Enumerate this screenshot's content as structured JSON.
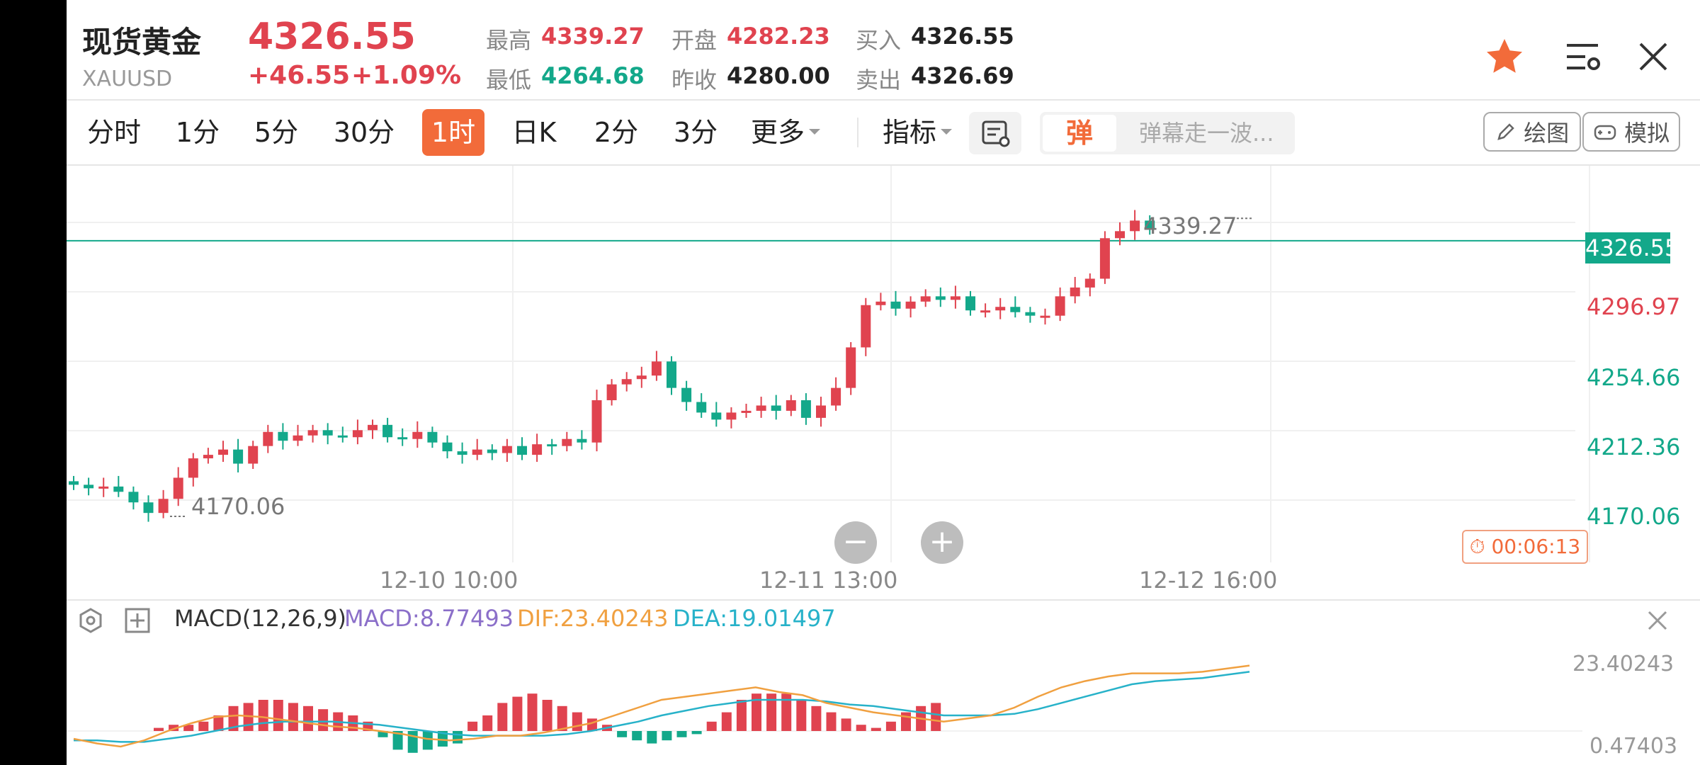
{
  "header": {
    "name": "现货黄金",
    "code": "XAUUSD",
    "price": "4326.55",
    "change": "+46.55",
    "change_pct": "+1.09%",
    "stats": [
      {
        "label": "最高",
        "value": "4339.27",
        "color": "#e0434f"
      },
      {
        "label": "最低",
        "value": "4264.68",
        "color": "#13a88a"
      },
      {
        "label": "开盘",
        "value": "4282.23",
        "color": "#e0434f"
      },
      {
        "label": "昨收",
        "value": "4280.00",
        "color": "#222222"
      },
      {
        "label": "买入",
        "value": "4326.55",
        "color": "#222222"
      },
      {
        "label": "卖出",
        "value": "4326.69",
        "color": "#222222"
      }
    ]
  },
  "tabs": [
    "分时",
    "1分",
    "5分",
    "30分",
    "1时",
    "日K",
    "2分",
    "3分",
    "更多"
  ],
  "active_tab": "1时",
  "toolbar": {
    "indicator_label": "指标",
    "danmaku_badge": "弹",
    "danmaku_placeholder": "弹幕走一波...",
    "draw_label": "绘图",
    "simulate_label": "模拟"
  },
  "chart": {
    "y_labels": [
      "4326.55",
      "4296.97",
      "4254.66",
      "4212.36",
      "4170.06"
    ],
    "current_price_tag": "4326.55",
    "high_marker": "4339.27",
    "low_marker": "4170.06",
    "x_labels": [
      "12-10 10:00",
      "12-11 13:00",
      "12-12 16:00"
    ],
    "countdown": "00:06:13",
    "zoom_out": "−",
    "zoom_in": "+"
  },
  "macd": {
    "title": "MACD(12,26,9)",
    "macd": "MACD:8.77493",
    "dif": "DIF:23.40243",
    "dea": "DEA:19.01497",
    "right_label": "23.40243",
    "bottom_label": "0.47403"
  },
  "colors": {
    "up": "#e0434f",
    "down": "#13a88a",
    "accent": "#f26b3a",
    "dif": "#f0a040",
    "dea": "#27b2c9",
    "macd_text": "#8b6fc9"
  },
  "chart_data": {
    "type": "candlestick",
    "interval": "1h",
    "high": 4339.27,
    "low": 4170.06,
    "last": 4326.55,
    "closes": [
      4188,
      4186,
      4187,
      4184,
      4178,
      4172,
      4180,
      4192,
      4203,
      4205,
      4208,
      4200,
      4210,
      4218,
      4213,
      4216,
      4219,
      4216,
      4215,
      4219,
      4222,
      4215,
      4214,
      4218,
      4212,
      4207,
      4205,
      4208,
      4206,
      4210,
      4205,
      4211,
      4210,
      4214,
      4212,
      4236,
      4245,
      4248,
      4250,
      4258,
      4243,
      4235,
      4229,
      4225,
      4229,
      4230,
      4233,
      4230,
      4236,
      4226,
      4233,
      4243,
      4266,
      4290,
      4292,
      4288,
      4292,
      4295,
      4293,
      4295,
      4287,
      4287,
      4289,
      4286,
      4284,
      4284,
      4295,
      4300,
      4305,
      4328,
      4332,
      4338,
      4333
    ],
    "macd": {
      "dif": [
        -5,
        -8,
        -10,
        -6,
        0,
        5,
        9,
        10,
        9,
        7,
        5,
        3,
        2,
        0,
        -2,
        -5,
        -6,
        -5,
        -3,
        -3,
        -1,
        2,
        5,
        10,
        15,
        20,
        22,
        24,
        26,
        28,
        25,
        23,
        18,
        15,
        12,
        10,
        8,
        6,
        8,
        10,
        15,
        22,
        28,
        32,
        35,
        37,
        37,
        37,
        38,
        40,
        42
      ],
      "dea": [
        -6,
        -6,
        -7,
        -7,
        -5,
        -3,
        0,
        3,
        5,
        6,
        6,
        6,
        5,
        4,
        2,
        0,
        -2,
        -3,
        -3,
        -3,
        -3,
        -2,
        0,
        3,
        6,
        10,
        13,
        16,
        18,
        20,
        20,
        20,
        19,
        17,
        16,
        14,
        12,
        10,
        10,
        10,
        11,
        14,
        18,
        22,
        26,
        30,
        32,
        33,
        34,
        36,
        38
      ],
      "bars": [
        1,
        2,
        2,
        3,
        5,
        8,
        9,
        10,
        10,
        9,
        8,
        7,
        6,
        5,
        3,
        -2,
        -6,
        -7,
        -6,
        -5,
        -4,
        3,
        5,
        9,
        11,
        12,
        10,
        8,
        6,
        4,
        2,
        -2,
        -3,
        -4,
        -3,
        -2,
        -1,
        3,
        6,
        10,
        12,
        12,
        12,
        10,
        8,
        6,
        4,
        2,
        1,
        3,
        6,
        8,
        9
      ]
    }
  }
}
